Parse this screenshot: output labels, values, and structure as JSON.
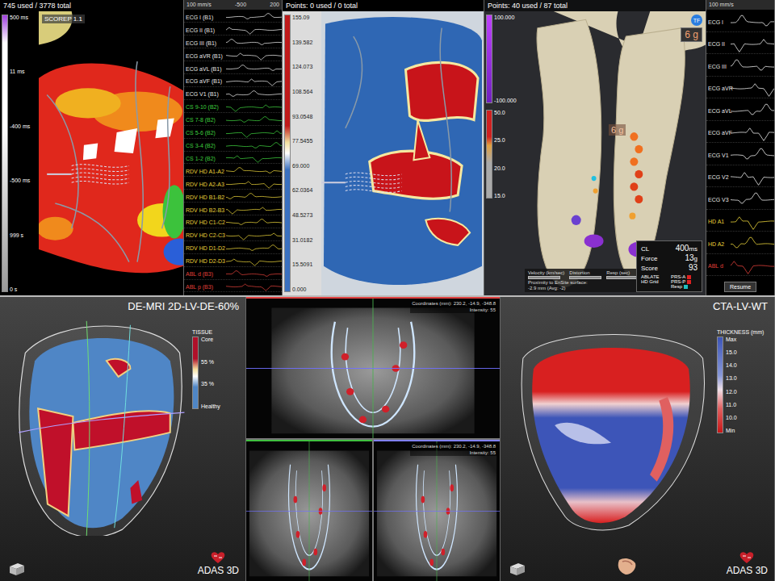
{
  "activation_panel": {
    "points": "745 used / 3778 total",
    "badge": "SCOREP 1.1",
    "scale": [
      "500 ms",
      "11 ms",
      "-400 ms",
      "-500 ms",
      "999 s",
      "0 s"
    ]
  },
  "left_signals": {
    "speed": "100 mm/s",
    "ticks": [
      "-500",
      "200"
    ],
    "channels": [
      {
        "label": "ECG I (B1)",
        "color": "#e8e8e8"
      },
      {
        "label": "ECG II (B1)",
        "color": "#e8e8e8"
      },
      {
        "label": "ECG III (B1)",
        "color": "#e8e8e8"
      },
      {
        "label": "ECG aVR (B1)",
        "color": "#e8e8e8"
      },
      {
        "label": "ECG aVL (B1)",
        "color": "#e8e8e8"
      },
      {
        "label": "ECG aVF (B1)",
        "color": "#e8e8e8"
      },
      {
        "label": "ECG V1 (B1)",
        "color": "#e8e8e8"
      },
      {
        "label": "CS 9-10 (B2)",
        "color": "#3fd13f"
      },
      {
        "label": "CS 7-8 (B2)",
        "color": "#3fd13f"
      },
      {
        "label": "CS 5-6 (B2)",
        "color": "#3fd13f"
      },
      {
        "label": "CS 3-4 (B2)",
        "color": "#3fd13f"
      },
      {
        "label": "CS 1-2 (B2)",
        "color": "#3fd13f"
      },
      {
        "label": "RDV HD A1-A2",
        "color": "#e8d23a"
      },
      {
        "label": "RDV HD A2-A3",
        "color": "#e8d23a"
      },
      {
        "label": "RDV HD B1-B2",
        "color": "#e8d23a"
      },
      {
        "label": "RDV HD B2-B3",
        "color": "#e8d23a"
      },
      {
        "label": "RDV HD C1-C2",
        "color": "#e8d23a"
      },
      {
        "label": "RDV HD C2-C3",
        "color": "#e8d23a"
      },
      {
        "label": "RDV HD D1-D2",
        "color": "#e8d23a"
      },
      {
        "label": "RDV HD D2-D3",
        "color": "#e8d23a"
      },
      {
        "label": "ABL d (B3)",
        "color": "#e0403a"
      },
      {
        "label": "ABL p (B3)",
        "color": "#e0403a"
      }
    ]
  },
  "voltage_panel": {
    "points": "Points: 0 used / 0 total",
    "scale": [
      "155.09",
      "139.582",
      "124.073",
      "108.564",
      "93.0548",
      "77.5455",
      "69.000",
      "62.0364",
      "48.5273",
      "31.0182",
      "15.5091",
      "0.000"
    ]
  },
  "anatomy_panel": {
    "points": "Points: 40 used / 87 total",
    "force_badge": "6 g",
    "force_readout": "6 g",
    "tf": "TF",
    "velocity_scale": [
      "100.000",
      "-100.000"
    ],
    "threshold_scale": [
      "50.0",
      "25.0",
      "20.0",
      "15.0"
    ],
    "readings": [
      {
        "label": "CL",
        "value": "400",
        "unit": "ms"
      },
      {
        "label": "Force",
        "value": "13",
        "unit": "g"
      },
      {
        "label": "Score",
        "value": "93",
        "unit": ""
      }
    ],
    "legend": [
      {
        "label": "ABLATE"
      },
      {
        "label": "HD Grid"
      }
    ],
    "markers": [
      {
        "label": "PRS-A",
        "color": "#e02020"
      },
      {
        "label": "PRS-P",
        "color": "#e02020"
      },
      {
        "label": "Resp",
        "color": "#20c0c0"
      }
    ],
    "controls": [
      "Velocity (km/sec)",
      "Distortion",
      "Resp (sec)"
    ],
    "proximity": "Proximity to EnSite surface:",
    "proximity_value": "-2.9 mm (Avg: -2)"
  },
  "right_signals": {
    "speed": "100 mm/s",
    "button": "Resume",
    "channels": [
      {
        "label": "ECG I",
        "color": "#e8e8e8"
      },
      {
        "label": "ECG II",
        "color": "#e8e8e8"
      },
      {
        "label": "ECG III",
        "color": "#e8e8e8"
      },
      {
        "label": "ECG aVR",
        "color": "#e8e8e8"
      },
      {
        "label": "ECG aVL",
        "color": "#e8e8e8"
      },
      {
        "label": "ECG aVF",
        "color": "#e8e8e8"
      },
      {
        "label": "ECG V1",
        "color": "#e8e8e8"
      },
      {
        "label": "ECG V2",
        "color": "#e8e8e8"
      },
      {
        "label": "ECG V3",
        "color": "#e8e8e8"
      },
      {
        "label": "HD A1",
        "color": "#e8d23a"
      },
      {
        "label": "HD A2",
        "color": "#e8d23a"
      },
      {
        "label": "ABL d",
        "color": "#e0403a"
      }
    ]
  },
  "de_mri": {
    "title": "DE-MRI 2D-LV-DE-60%",
    "legend_title": "TISSUE",
    "legend_labels": [
      "Core",
      "55 %",
      "35 %",
      "Healthy"
    ],
    "brand": "ADAS 3D"
  },
  "slices": {
    "views": [
      {
        "captions": [
          "Coordinates (mm): 230.2, -14.9, -348.8",
          "Intensity: 55"
        ]
      },
      {
        "captions": []
      },
      {
        "captions": [
          "Coordinates (mm): 230.2, -14.9, -348.8",
          "Intensity: 55"
        ]
      }
    ]
  },
  "cta": {
    "title": "CTA-LV-WT",
    "legend_title": "THICKNESS (mm)",
    "legend_labels": [
      "Max",
      "15.0",
      "14.0",
      "13.0",
      "12.0",
      "11.0",
      "10.0",
      "Min"
    ],
    "brand": "ADAS 3D"
  }
}
